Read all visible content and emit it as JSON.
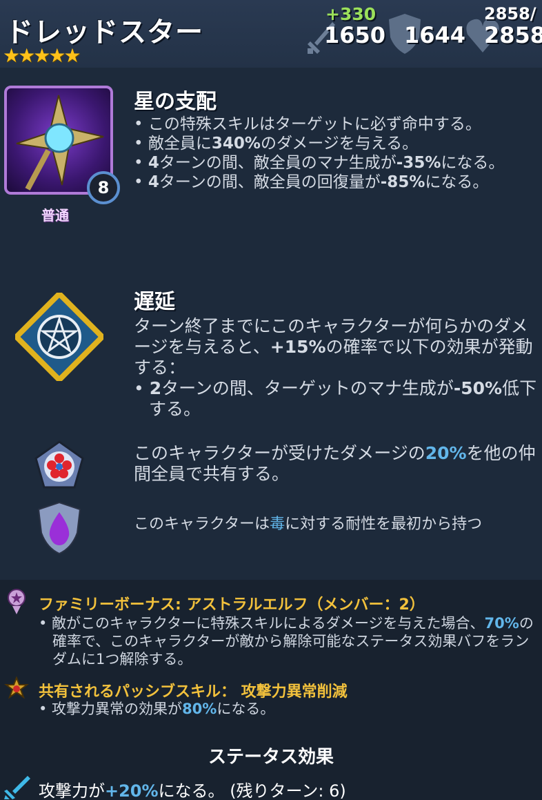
{
  "header": {
    "hero_name": "ドレッドスター",
    "stars": "★★★★★",
    "attack_bonus": "+330",
    "attack": "1650",
    "defense": "1644",
    "health_max": "2858/",
    "health": "2858"
  },
  "special_skill": {
    "name": "星の支配",
    "level": "8",
    "rarity": "普通",
    "lines": [
      {
        "pre": "• この特殊スキルはターゲットに必ず命中する。",
        "b": "",
        "post": ""
      },
      {
        "pre": "• 敵全員に",
        "b": "340%",
        "post": "のダメージを与える。"
      },
      {
        "pre": "• ",
        "b": "4",
        "post": "ターンの間、敵全員のマナ生成が",
        "b2": "-35%",
        "post2": "になる。"
      },
      {
        "pre": "• ",
        "b": "4",
        "post": "ターンの間、敵全員の回復量が",
        "b2": "-85%",
        "post2": "になる。"
      }
    ]
  },
  "delay_skill": {
    "name": "遅延",
    "text_pre": "ターン終了までにこのキャラクターが何らかのダメージを与えると、",
    "text_b": "+15%",
    "text_post": "の確率で以下の効果が発動する：",
    "bullet_pre": "• ",
    "bullet_b": "2",
    "bullet_mid": "ターンの間、ターゲットのマナ生成が",
    "bullet_b2": "-50%",
    "bullet_post": "低下する。"
  },
  "passive_share": {
    "pre": "このキャラクターが受けたダメージの",
    "value": "20%",
    "post": "を他の仲間全員で共有する。"
  },
  "passive_resist": {
    "pre": "このキャラクターは",
    "value": "毒",
    "post": "に対する耐性を最初から持つ"
  },
  "family_bonus": {
    "title": "ファミリーボーナス: アストラルエルフ（メンバー：2）",
    "pre": "• 敵がこのキャラクターに特殊スキルによるダメージを与えた場合、",
    "value": "70%",
    "post": "の確率で、このキャラクターが敵から解除可能なステータス効果バフをランダムに1つ解除する。"
  },
  "shared_passive": {
    "title": "共有されるパッシブスキル： 攻撃力異常削減",
    "pre": "• 攻撃力異常の効果が",
    "value": "80%",
    "post": "になる。"
  },
  "status_effects": {
    "title": "ステータス効果",
    "pre": "攻撃力が",
    "value": "+20%",
    "post": "になる。 (残りターン: 6)"
  }
}
